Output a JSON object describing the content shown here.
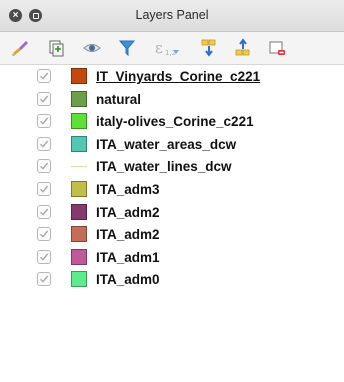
{
  "window": {
    "title": "Layers Panel"
  },
  "toolbar": {
    "buttons": [
      {
        "icon": "paintbrush-style-icon"
      },
      {
        "icon": "add-group-icon"
      },
      {
        "icon": "eye-visibility-icon"
      },
      {
        "icon": "filter-icon"
      },
      {
        "icon": "filter-expression-icon"
      },
      {
        "icon": "expand-all-icon"
      },
      {
        "icon": "collapse-all-icon"
      },
      {
        "icon": "remove-layer-icon"
      }
    ]
  },
  "layers": [
    {
      "name": "IT_Vinyards_Corine_c221",
      "color": "#c24a0e",
      "checked": true,
      "selected": true
    },
    {
      "name": "natural",
      "color": "#6aa04a",
      "checked": true
    },
    {
      "name": "italy-olives_Corine_c221",
      "color": "#5ee03a",
      "checked": true
    },
    {
      "name": "ITA_water_areas_dcw",
      "color": "#52c7b4",
      "checked": true
    },
    {
      "name": "ITA_water_lines_dcw",
      "color": "#e8d9a6",
      "checked": true,
      "line": true
    },
    {
      "name": "ITA_adm3",
      "color": "#bfbf4a",
      "checked": true
    },
    {
      "name": "ITA_adm2",
      "color": "#843a6e",
      "checked": true
    },
    {
      "name": "ITA_adm2",
      "color": "#c46e58",
      "checked": true
    },
    {
      "name": "ITA_adm1",
      "color": "#bf5a9a",
      "checked": true
    },
    {
      "name": "ITA_adm0",
      "color": "#5cec8e",
      "checked": true
    }
  ]
}
